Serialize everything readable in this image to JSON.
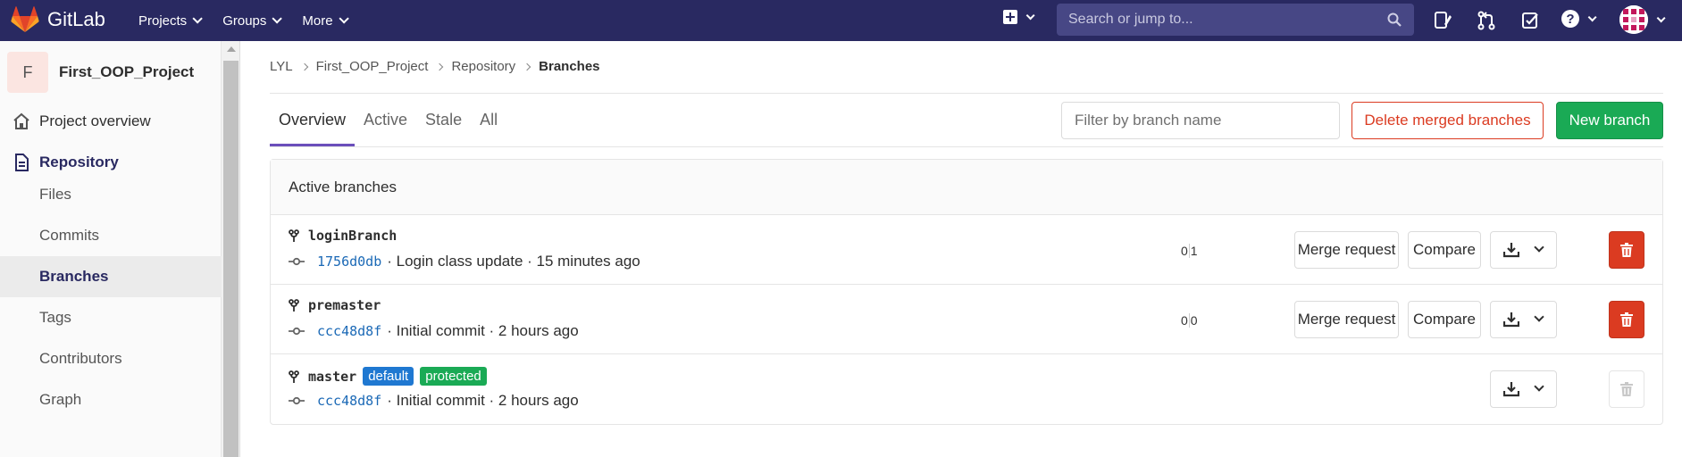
{
  "navbar": {
    "brand": "GitLab",
    "menu": [
      {
        "label": "Projects"
      },
      {
        "label": "Groups"
      },
      {
        "label": "More"
      }
    ],
    "search_placeholder": "Search or jump to...",
    "help_glyph": "?",
    "colors": {
      "bg": "#292961",
      "search_bg": "#474785"
    }
  },
  "sidebar": {
    "project_avatar_letter": "F",
    "project_name": "First_OOP_Project",
    "items": [
      {
        "label": "Project overview",
        "icon": "home-icon"
      },
      {
        "label": "Repository",
        "icon": "document-icon"
      }
    ],
    "sub_items": [
      {
        "label": "Files"
      },
      {
        "label": "Commits"
      },
      {
        "label": "Branches",
        "active": true
      },
      {
        "label": "Tags"
      },
      {
        "label": "Contributors"
      },
      {
        "label": "Graph"
      }
    ]
  },
  "breadcrumb": {
    "items": [
      "LYL",
      "First_OOP_Project",
      "Repository"
    ],
    "current": "Branches"
  },
  "tabs": [
    {
      "label": "Overview",
      "active": true
    },
    {
      "label": "Active"
    },
    {
      "label": "Stale"
    },
    {
      "label": "All"
    }
  ],
  "filter": {
    "placeholder": "Filter by branch name"
  },
  "buttons": {
    "delete_merged": "Delete merged branches",
    "new_branch": "New branch",
    "merge_request": "Merge request",
    "compare": "Compare"
  },
  "card": {
    "title": "Active branches",
    "branches": [
      {
        "name": "loginBranch",
        "sha": "1756d0db",
        "message": "· Login class update · 15 minutes ago",
        "behind": "0",
        "ahead": "1"
      },
      {
        "name": "premaster",
        "sha": "ccc48d8f",
        "message": "· Initial commit · 2 hours ago",
        "behind": "0",
        "ahead": "0"
      },
      {
        "name": "master",
        "sha": "ccc48d8f",
        "message": "· Initial commit · 2 hours ago",
        "badges": [
          "default",
          "protected"
        ]
      }
    ]
  },
  "colors": {
    "accent_purple": "#6b4fbb",
    "danger_red": "#db3b21",
    "success_green": "#1aaa55",
    "link_blue": "#1b69b6",
    "badge_blue": "#1f78d1"
  }
}
